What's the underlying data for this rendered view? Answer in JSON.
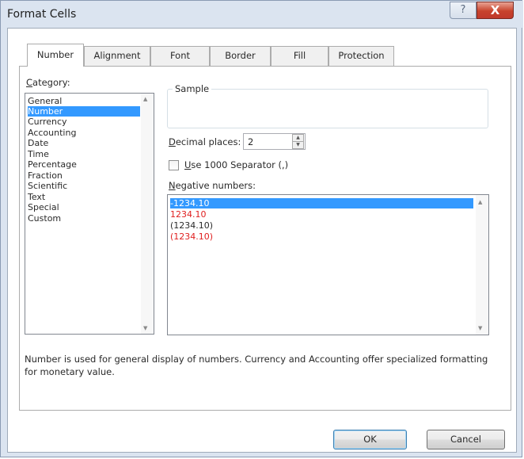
{
  "window": {
    "title": "Format Cells"
  },
  "titlebar": {
    "help_icon": "?",
    "close_icon": "X"
  },
  "tabs": [
    {
      "label": "Number",
      "active": true
    },
    {
      "label": "Alignment",
      "active": false
    },
    {
      "label": "Font",
      "active": false
    },
    {
      "label": "Border",
      "active": false
    },
    {
      "label": "Fill",
      "active": false
    },
    {
      "label": "Protection",
      "active": false
    }
  ],
  "category": {
    "label_accel": "C",
    "label_rest": "ategory:",
    "items": [
      "General",
      "Number",
      "Currency",
      "Accounting",
      "Date",
      "Time",
      "Percentage",
      "Fraction",
      "Scientific",
      "Text",
      "Special",
      "Custom"
    ],
    "selected_index": 1
  },
  "sample": {
    "label": "Sample",
    "value": ""
  },
  "decimal_places": {
    "label_accel": "D",
    "label_rest": "ecimal places:",
    "value": "2"
  },
  "separator": {
    "label_accel": "U",
    "label_rest": "se 1000 Separator (,)",
    "checked": false
  },
  "negative_numbers": {
    "label_accel": "N",
    "label_rest": "egative numbers:",
    "items": [
      {
        "text": "-1234.10",
        "color": "#1e1e1e"
      },
      {
        "text": "1234.10",
        "color": "#e02020"
      },
      {
        "text": "(1234.10)",
        "color": "#1e1e1e"
      },
      {
        "text": "(1234.10)",
        "color": "#e02020"
      }
    ],
    "selected_index": 0
  },
  "description": "Number is used for general display of numbers.  Currency and Accounting offer specialized formatting for monetary value.",
  "buttons": {
    "ok": "OK",
    "cancel": "Cancel"
  },
  "colors": {
    "selection": "#3399ff",
    "close_button": "#c7432c",
    "negative_red": "#e02020"
  }
}
